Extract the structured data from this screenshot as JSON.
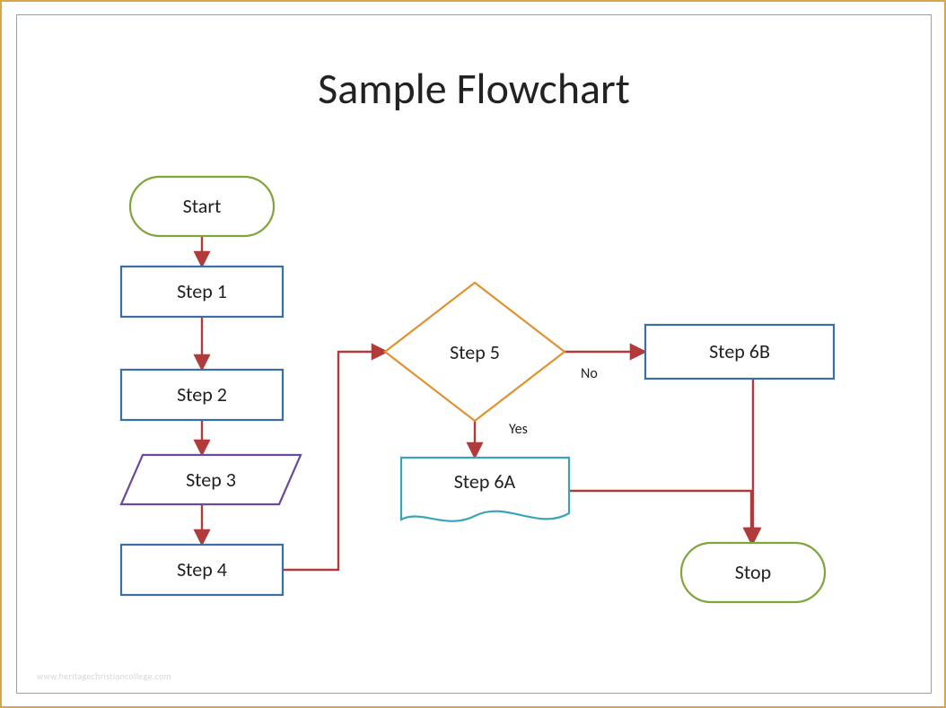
{
  "title": "Sample Flowchart",
  "nodes": {
    "start": {
      "label": "Start"
    },
    "step1": {
      "label": "Step 1"
    },
    "step2": {
      "label": "Step 2"
    },
    "step3": {
      "label": "Step 3"
    },
    "step4": {
      "label": "Step 4"
    },
    "step5": {
      "label": "Step 5"
    },
    "step6a": {
      "label": "Step 6A"
    },
    "step6b": {
      "label": "Step 6B"
    },
    "stop": {
      "label": "Stop"
    }
  },
  "edges": {
    "no": {
      "label": "No"
    },
    "yes": {
      "label": "Yes"
    }
  },
  "watermark": "www.heritagechristiancollege.com",
  "colors": {
    "terminator_stroke": "#7fa63a",
    "process_stroke": "#3a6ea5",
    "io_stroke": "#6b4a9a",
    "decision_stroke": "#e0922f",
    "document_stroke": "#3aa5b8",
    "connector_stroke": "#b13a3a"
  }
}
